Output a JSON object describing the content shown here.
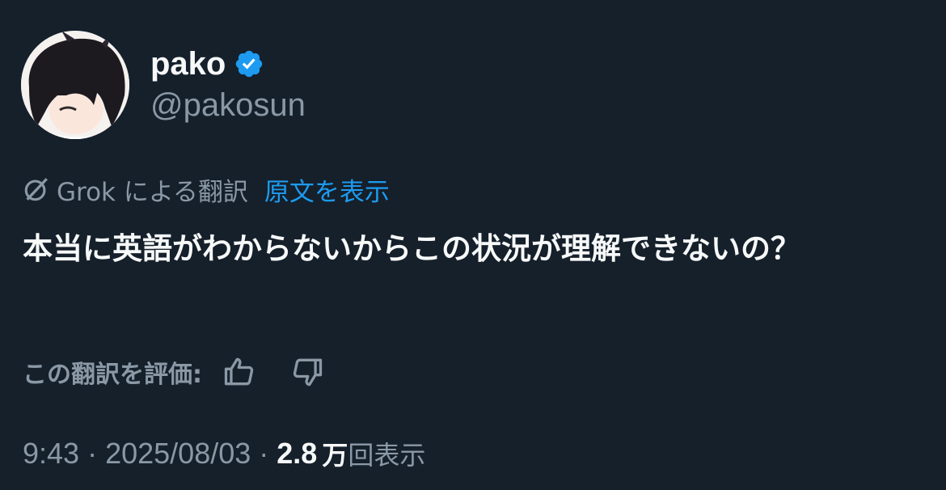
{
  "author": {
    "display_name": "pako",
    "handle": "@pakosun",
    "verified_icon": "verified-badge-icon"
  },
  "translation": {
    "translated_by": "Grok による翻訳",
    "show_original": "原文を表示",
    "icon": "grok-icon"
  },
  "tweet": {
    "text": "本当に英語がわからないからこの状況が理解できないの？"
  },
  "rating": {
    "label": "この翻訳を評価:",
    "like_icon": "thumbs-up-icon",
    "dislike_icon": "thumbs-down-icon"
  },
  "meta": {
    "time": "9:43",
    "separator": "·",
    "date": "2025/08/03",
    "views_count": "2.8",
    "views_unit": "万",
    "views_label": "回表示"
  },
  "colors": {
    "background": "#15202b",
    "accent": "#1d9bf0",
    "muted": "#8b98a5",
    "text": "#f7f9f9"
  }
}
